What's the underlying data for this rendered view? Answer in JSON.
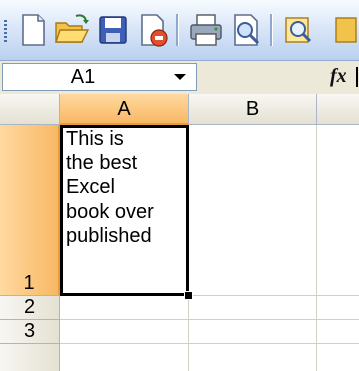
{
  "name_box": {
    "value": "A1"
  },
  "formula_bar": {
    "fx_label": "fx"
  },
  "columns": [
    "A",
    "B"
  ],
  "rows": [
    "1",
    "2",
    "3"
  ],
  "cells": {
    "A1": {
      "lines": [
        "This is",
        "the best",
        "Excel",
        "book over",
        "published"
      ]
    }
  },
  "colors": {
    "selected_header": "#f8b864",
    "toolbar": "#c8dcf4",
    "grid_line": "#d4d0c8"
  }
}
